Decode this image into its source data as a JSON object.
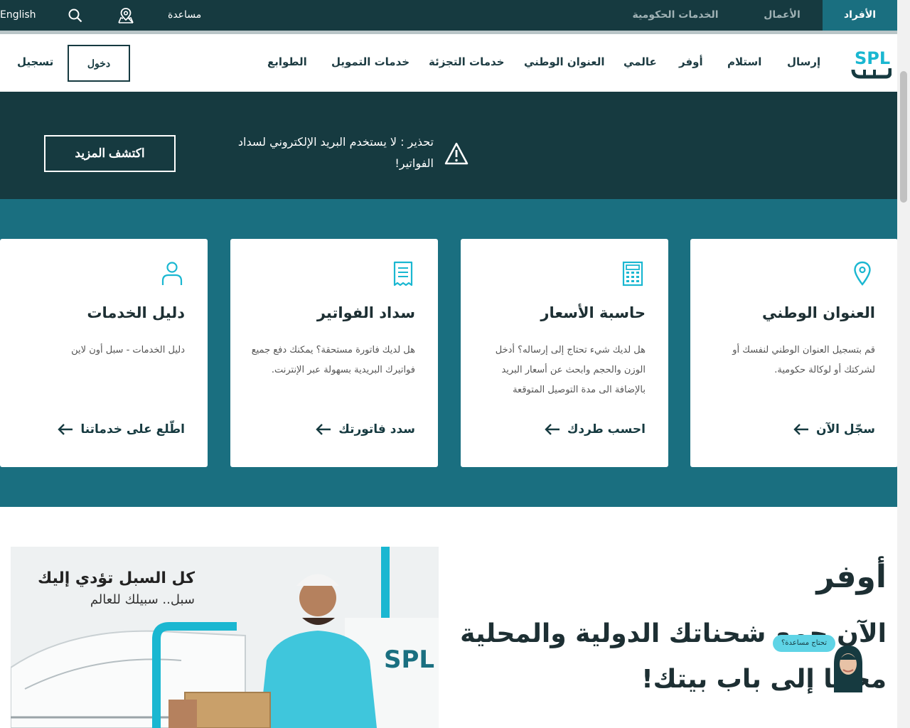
{
  "topbar": {
    "tabs": [
      {
        "label": "الأفراد",
        "active": true
      },
      {
        "label": "الأعمال",
        "active": false
      },
      {
        "label": "الخدمات الحكومية",
        "active": false
      }
    ],
    "help_label": "مساعدة",
    "language_label": "English"
  },
  "navbar": {
    "logo_text": "SPL",
    "items": [
      "إرسال",
      "استلام",
      "أوفر",
      "عالمي",
      "العنوان الوطني",
      "خدمات التجزئة",
      "خدمات التمويل",
      "الطوابع"
    ],
    "login_label": "دخول",
    "register_label": "تسجيل"
  },
  "warning": {
    "text": "تحذير : لا يستخدم البريد الإلكتروني لسداد الفواتير!",
    "button_label": "اكتشف المزيد"
  },
  "cards": [
    {
      "title": "العنوان الوطني",
      "desc": "قم بتسجيل العنوان الوطني لنفسك أو لشركتك أو لوكالة حكومية.",
      "link": "سجّل الآن",
      "icon": "location-pin-icon"
    },
    {
      "title": "حاسبة الأسعار",
      "desc": "هل لديك شيء تحتاج إلى إرساله؟ أدخل الوزن والحجم وابحث عن أسعار البريد بالإضافة الى مدة التوصيل المتوقعة",
      "link": "احسب طردك",
      "icon": "calculator-icon"
    },
    {
      "title": "سداد الفواتير",
      "desc": "هل لديك فاتورة مستحقة؟ يمكنك دفع جميع فواتيرك البريدية بسهولة عبر الإنترنت.",
      "link": "سدد فاتورتك",
      "icon": "receipt-icon"
    },
    {
      "title": "دليل الخدمات",
      "desc": "دليل الخدمات - سبل أون لاين",
      "link": "اطّلع على خدماتنا",
      "icon": "user-icon"
    }
  ],
  "promo": {
    "title": "كل السبل تؤدي إليك",
    "subtitle": "سبل.. سبيلك للعالم"
  },
  "offer": {
    "title": "أوفر",
    "headline": "الآن جمع شحناتك الدولية والمحلية مجانا إلى باب بيتك!"
  },
  "help_widget": {
    "label": "تحتاج مساعدة؟"
  },
  "colors": {
    "dark_teal": "#163a40",
    "teal": "#1a6f80",
    "accent_cyan": "#1ab7d1"
  }
}
